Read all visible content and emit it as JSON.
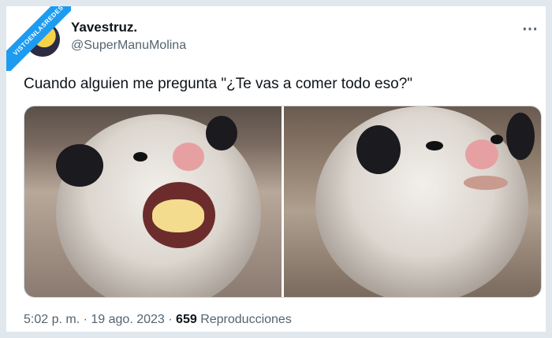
{
  "watermark": "VISTOENLASREDES",
  "author": {
    "name": "Yavestruz.",
    "handle": "@SuperManuMolina"
  },
  "tweet": {
    "text": "Cuando alguien me pregunta \"¿Te vas a comer todo eso?\""
  },
  "meta": {
    "time": "5:02 p. m.",
    "separator": "·",
    "date": "19 ago. 2023",
    "views": "659",
    "views_label": "Reproducciones"
  },
  "icons": {
    "more": "more-options-icon"
  },
  "colors": {
    "accent": "#1d9bf0",
    "text": "#0f1419",
    "muted": "#536471",
    "border": "#e1e8ed"
  }
}
